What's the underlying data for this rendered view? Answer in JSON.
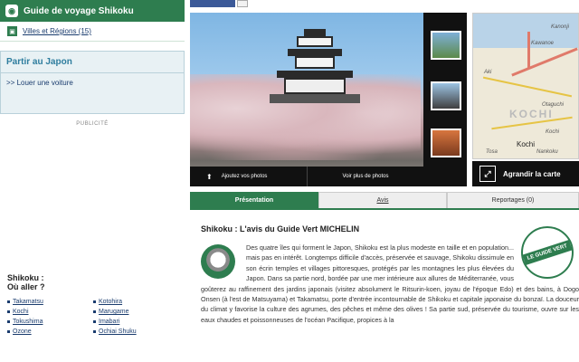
{
  "sidebar": {
    "guide_title": "Guide de voyage Shikoku",
    "villes_link": "Villes et Régions (15)",
    "partir_title": "Partir au Japon",
    "partir_link": ">> Louer une voiture",
    "pub_label": "PUBLICITÉ",
    "where_title": "Shikoku :",
    "where_subtitle": "Où aller ?",
    "places": [
      "Takamatsu",
      "Kotohira",
      "Kochi",
      "Marugame",
      "Tokushima",
      "Imabari",
      "Ozone",
      "Ochiai Shuku"
    ]
  },
  "photo": {
    "add_label": "Ajoutez vos photos",
    "more_label": "Voir plus de photos"
  },
  "map": {
    "labels": [
      "Kanonji",
      "Kawanoe",
      "Otaguchi",
      "Kochi",
      "Nankoku",
      "Aki",
      "Tosa"
    ],
    "region_label": "KOCHI",
    "city_label": "Kochi",
    "enlarge_label": "Agrandir la carte"
  },
  "tabs": [
    {
      "label": "Présentation"
    },
    {
      "label": "Avis"
    },
    {
      "label": "Reportages (0)"
    }
  ],
  "article": {
    "title": "Shikoku : L'avis du Guide Vert MICHELIN",
    "seal_text": "LE GUIDE VERT",
    "body": "Des quatre îles qui forment le Japon, Shikoku est la plus modeste en taille et en population... mais pas en intérêt. Longtemps difficile d'accès, préservée et sauvage, Shikoku dissimule en son écrin temples et villages pittoresques, protégés par les montagnes les plus élevées du Japon. Dans sa partie nord, bordée par une mer intérieure aux allures de Méditerranée, vous goûterez au raffinement des jardins japonais (visitez absolument le Ritsurin-koen, joyau de l'époque Edo) et des bains, à Dogo Onsen (à l'est de Matsuyama) et Takamatsu, porte d'entrée incontournable de Shikoku et capitale japonaise du bonzaï. La douceur du climat y favorise la culture des agrumes, des pêches et même des olives ! Sa partie sud, préservée du tourisme, ouvre sur les eaux chaudes et poissonneuses de l'océan Pacifique, propices à la"
  },
  "colors": {
    "accent": "#2e7d4f",
    "link": "#1a3c6e"
  }
}
